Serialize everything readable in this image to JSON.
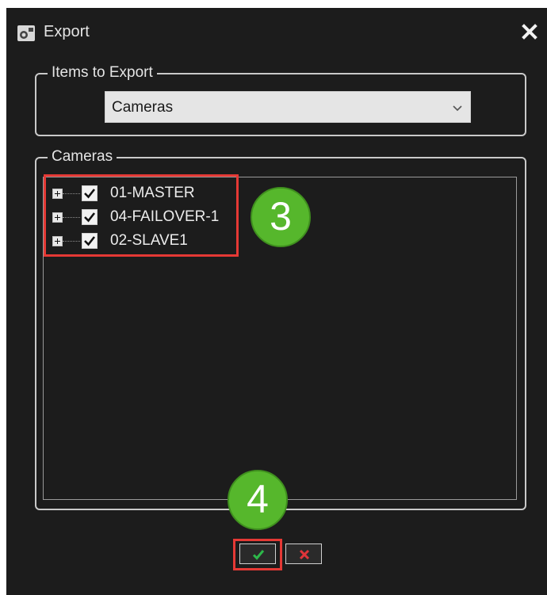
{
  "dialog": {
    "title": "Export",
    "icon": "export-app-icon",
    "close_icon": "close-icon"
  },
  "items_to_export": {
    "legend": "Items to Export",
    "selected": "Cameras",
    "dropdown_icon": "chevron-down-icon"
  },
  "cameras": {
    "legend": "Cameras",
    "items": [
      {
        "label": "01-MASTER",
        "checked": true,
        "expander": "plus"
      },
      {
        "label": "04-FAILOVER-1",
        "checked": true,
        "expander": "plus"
      },
      {
        "label": "02-SLAVE1",
        "checked": true,
        "expander": "plus"
      }
    ]
  },
  "annotations": {
    "step3": "3",
    "step4": "4",
    "badge_color": "#56b72c",
    "highlight_color": "#e53935"
  },
  "buttons": {
    "ok_icon": "check-icon",
    "ok_color": "#2db84a",
    "cancel_icon": "x-icon",
    "cancel_color": "#e0353a"
  }
}
